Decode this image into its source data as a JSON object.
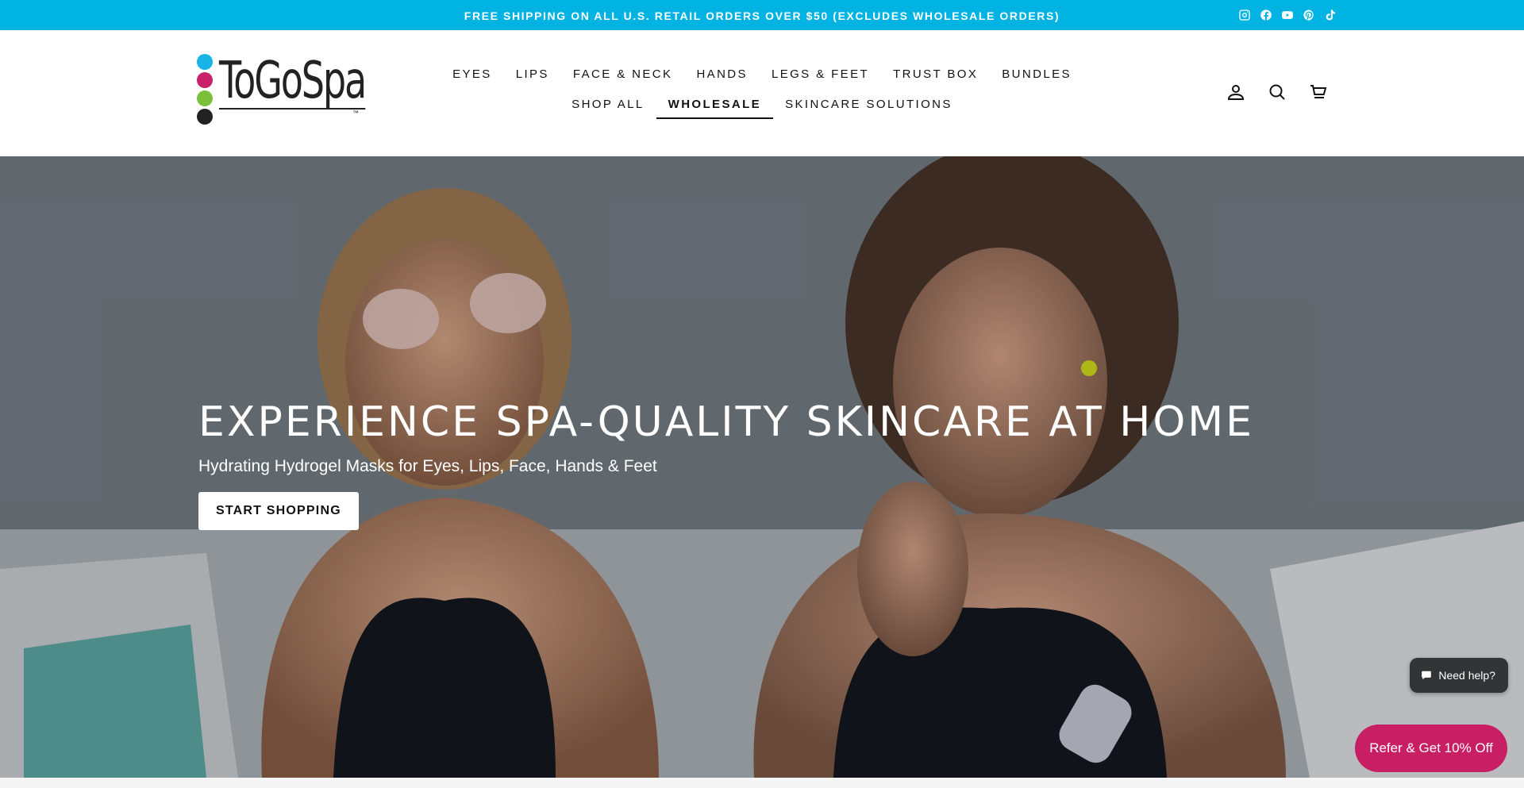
{
  "announcement": {
    "text": "FREE SHIPPING ON ALL U.S. RETAIL ORDERS OVER $50 (EXCLUDES WHOLESALE ORDERS)",
    "background": "#00b3e3",
    "social_icons": [
      "instagram-icon",
      "facebook-icon",
      "youtube-icon",
      "pinterest-icon",
      "tiktok-icon"
    ]
  },
  "logo": {
    "text": "ToGoSpa",
    "tm": "™",
    "dot_colors": [
      "#18b4e6",
      "#c8206a",
      "#7cbf3b",
      "#222222"
    ]
  },
  "nav": {
    "items": [
      "EYES",
      "LIPS",
      "FACE & NECK",
      "HANDS",
      "LEGS & FEET",
      "TRUST BOX",
      "BUNDLES",
      "SHOP ALL",
      "WHOLESALE",
      "SKINCARE SOLUTIONS"
    ],
    "active": "WHOLESALE"
  },
  "header_icons": [
    "account-icon",
    "search-icon",
    "cart-icon"
  ],
  "hero": {
    "title": "EXPERIENCE SPA-QUALITY SKINCARE AT HOME",
    "subtitle": "Hydrating Hydrogel Masks for Eyes, Lips, Face, Hands & Feet",
    "button_label": "START SHOPPING"
  },
  "widgets": {
    "help_label": "Need help?",
    "refer_label": "Refer & Get 10% Off",
    "refer_color": "#c81e63"
  }
}
